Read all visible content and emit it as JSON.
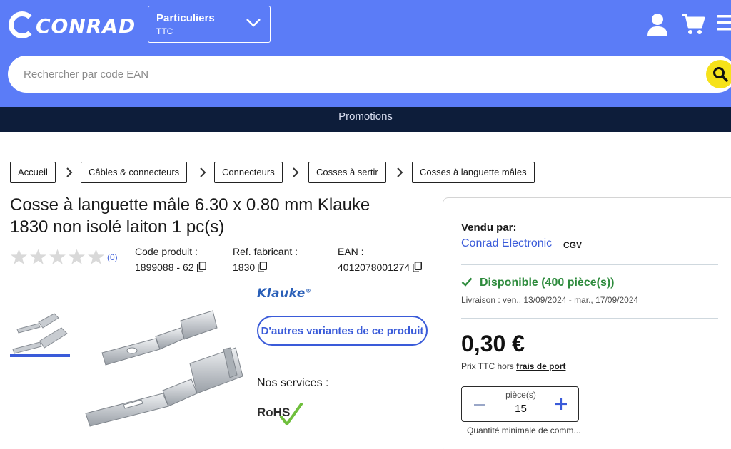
{
  "header": {
    "logo_text": "CONRAD",
    "customer_type": {
      "title": "Particuliers",
      "subtitle": "TTC"
    },
    "search": {
      "placeholder": "Rechercher par code EAN"
    },
    "promo_label": "Promotions"
  },
  "breadcrumb": [
    "Accueil",
    "Câbles & connecteurs",
    "Connecteurs",
    "Cosses à sertir",
    "Cosses à languette mâles"
  ],
  "product": {
    "title": "Cosse à languette mâle 6.30 x 0.80 mm Klauke 1830 non isolé laiton 1 pc(s)",
    "rating_count": "(0)",
    "rating_stars": 0,
    "code_label": "Code produit :",
    "code_value": "1899088 - 62",
    "ref_label": "Ref. fabricant :",
    "ref_value": "1830",
    "ean_label": "EAN :",
    "ean_value": "4012078001274",
    "brand": "Klauke",
    "variants_button": "D'autres variantes de ce produit",
    "services_label": "Nos services :",
    "rohs_label": "RoHS"
  },
  "offer": {
    "sold_by_label": "Vendu par:",
    "seller": "Conrad Electronic",
    "cgv": "CGV",
    "availability": "Disponible (400 pièce(s))",
    "delivery": "Livraison : ven., 13/09/2024 - mar., 17/09/2024",
    "price": "0,30 €",
    "price_note_prefix": "Prix TTC hors ",
    "price_note_link": "frais de port",
    "qty_label": "pièce(s)",
    "qty_value": "15",
    "min_qty": "Quantité minimale de comm..."
  },
  "colors": {
    "header_blue": "#5b7cf7",
    "promo_navy": "#0d1d3a",
    "link_blue": "#3a5bd9",
    "search_yellow": "#f6e21a",
    "available_green": "#2e8b3d"
  }
}
